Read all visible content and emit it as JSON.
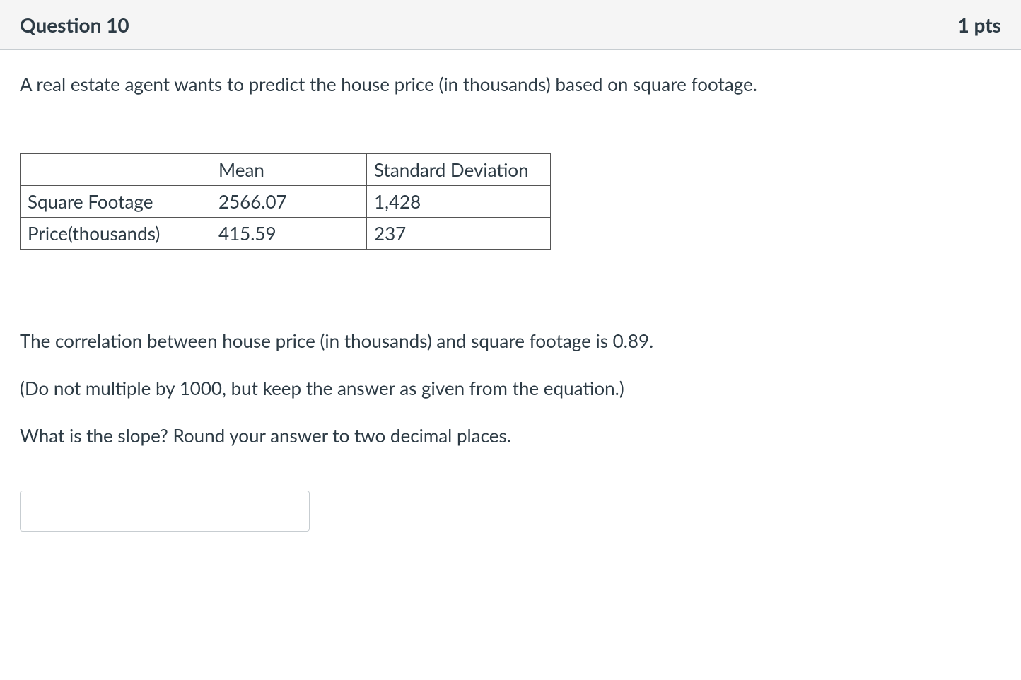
{
  "header": {
    "title": "Question 10",
    "points": "1 pts"
  },
  "body": {
    "intro": "A real estate agent wants to predict the house price  (in thousands)  based on square footage.",
    "table": {
      "headers": {
        "blank": "",
        "mean": "Mean",
        "sd": "Standard Deviation"
      },
      "rows": [
        {
          "label": "Square Footage",
          "mean": "2566.07",
          "sd": "1,428"
        },
        {
          "label": "Price(thousands)",
          "mean": "415.59",
          "sd": "237"
        }
      ]
    },
    "p1": "The correlation between house price (in thousands) and square footage is 0.89.",
    "p2": "(Do not multiple by 1000, but keep the answer as given from the equation.)",
    "p3": "What is the slope? Round your answer to two decimal places.",
    "answer_value": ""
  }
}
